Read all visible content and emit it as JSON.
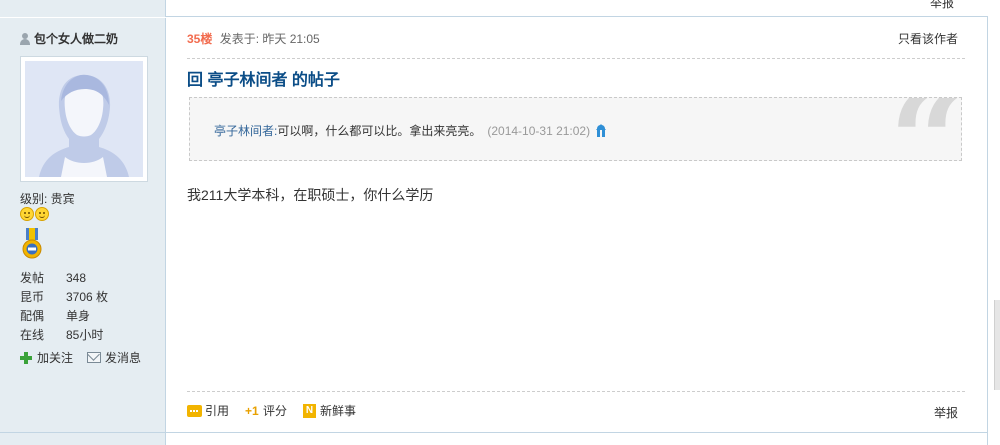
{
  "top": {
    "left_stub": "",
    "right_stub": "举报"
  },
  "sidebar": {
    "author": "包个女人做二奶",
    "level_label": "级别: 贵宾",
    "stats": [
      {
        "key": "发帖",
        "value": "348"
      },
      {
        "key": "昆币",
        "value": "3706 枚"
      },
      {
        "key": "配偶",
        "value": "单身"
      },
      {
        "key": "在线",
        "value": "85小时"
      }
    ],
    "follow_label": "加关注",
    "message_label": "发消息"
  },
  "post": {
    "floor": "35楼",
    "posted_at": "发表于: 昨天 21:05",
    "only_author": "只看该作者",
    "title": "回 亭子林间者 的帖子",
    "quote": {
      "author": "亭子林间者:",
      "text": "可以啊，什么都可以比。拿出来亮亮。",
      "date": "(2014-10-31 21:02)"
    },
    "body": "我211大学本科，在职硕士，你什么学历",
    "actions": {
      "quote": "引用",
      "rate": "评分",
      "news": "新鲜事"
    },
    "report": "举报"
  },
  "colors": {
    "accent": "#0b4d87",
    "floor": "#f26c4f",
    "sidebar_bg": "#e5edf2",
    "border": "#c2d5e3"
  }
}
